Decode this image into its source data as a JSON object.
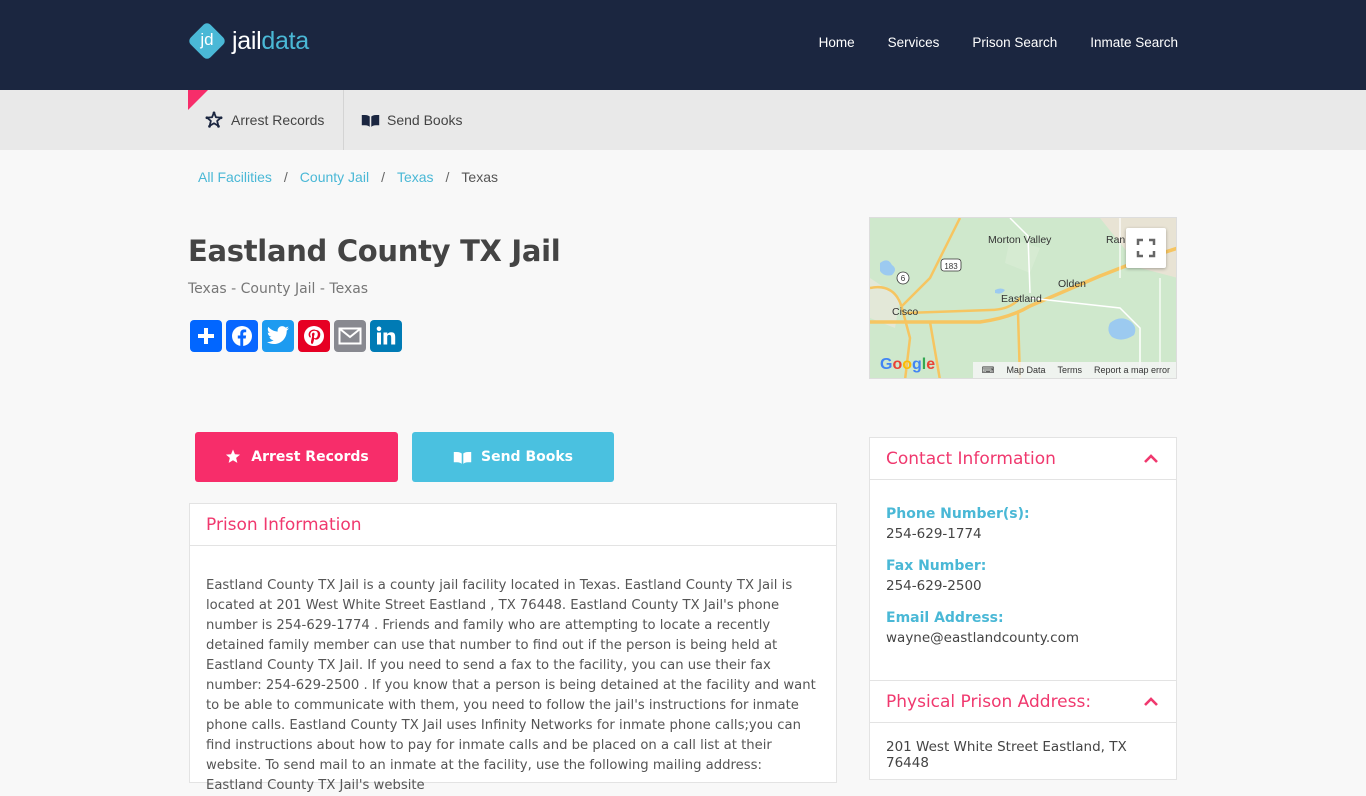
{
  "header": {
    "logo_mark": "jd",
    "logo_text_1": "jail",
    "logo_text_2": "data",
    "nav": [
      {
        "label": "Home"
      },
      {
        "label": "Services"
      },
      {
        "label": "Prison Search"
      },
      {
        "label": "Inmate Search"
      }
    ]
  },
  "subnav": {
    "items": [
      {
        "label": "Arrest Records",
        "icon": "sheriff-star-icon"
      },
      {
        "label": "Send Books",
        "icon": "book-icon"
      }
    ]
  },
  "breadcrumb": {
    "items": [
      {
        "label": "All Facilities"
      },
      {
        "label": "County Jail"
      },
      {
        "label": "Texas"
      }
    ],
    "current": "Texas",
    "separator": "/"
  },
  "page": {
    "title": "Eastland County TX Jail",
    "subtitle": "Texas - County Jail - Texas"
  },
  "share": [
    {
      "name": "share",
      "color": "#0166ff"
    },
    {
      "name": "facebook",
      "color": "#0866ff"
    },
    {
      "name": "twitter",
      "color": "#1d9bf0"
    },
    {
      "name": "pinterest",
      "color": "#e60023"
    },
    {
      "name": "email",
      "color": "#888990"
    },
    {
      "name": "linkedin",
      "color": "#007bb5"
    }
  ],
  "map": {
    "labels": [
      "Morton Valley",
      "Ran",
      "Olden",
      "Eastland",
      "Cisco"
    ],
    "shields": [
      "183",
      "6"
    ],
    "logo": "Google",
    "attribution": [
      "Map Data",
      "Terms",
      "Report a map error"
    ]
  },
  "actions": {
    "arrest_records": "Arrest Records",
    "send_books": "Send Books"
  },
  "prison_info": {
    "heading": "Prison Information",
    "text": "Eastland County TX Jail is a county jail facility located in Texas. Eastland County TX Jail is located at 201 West White Street Eastland , TX 76448. Eastland County TX Jail's phone number is 254-629-1774 . Friends and family who are attempting to locate a recently detained family member can use that number to find out if the person is being held at Eastland County TX Jail. If you need to send a fax to the facility, you can use their fax number: 254-629-2500 . If you know that a person is being detained at the facility and want to be able to communicate with them, you need to follow the jail's instructions for inmate phone calls. Eastland County TX Jail uses Infinity Networks for inmate phone calls;you can find instructions about how to pay for inmate calls and be placed on a call list at their website. To send mail to an inmate at the facility, use the following mailing address:   Eastland County TX Jail's website"
  },
  "contact": {
    "heading": "Contact Information",
    "phone_label": "Phone Number(s):",
    "phone": "254-629-1774",
    "fax_label": "Fax Number:",
    "fax": "254-629-2500",
    "email_label": "Email Address:",
    "email": "wayne@eastlandcounty.com"
  },
  "address": {
    "heading": "Physical Prison Address:",
    "value": "201 West White Street Eastland, TX 76448"
  },
  "colors": {
    "header_bg": "#1b2640",
    "accent_pink": "#f72d6a",
    "accent_blue": "#4ab8d6"
  }
}
